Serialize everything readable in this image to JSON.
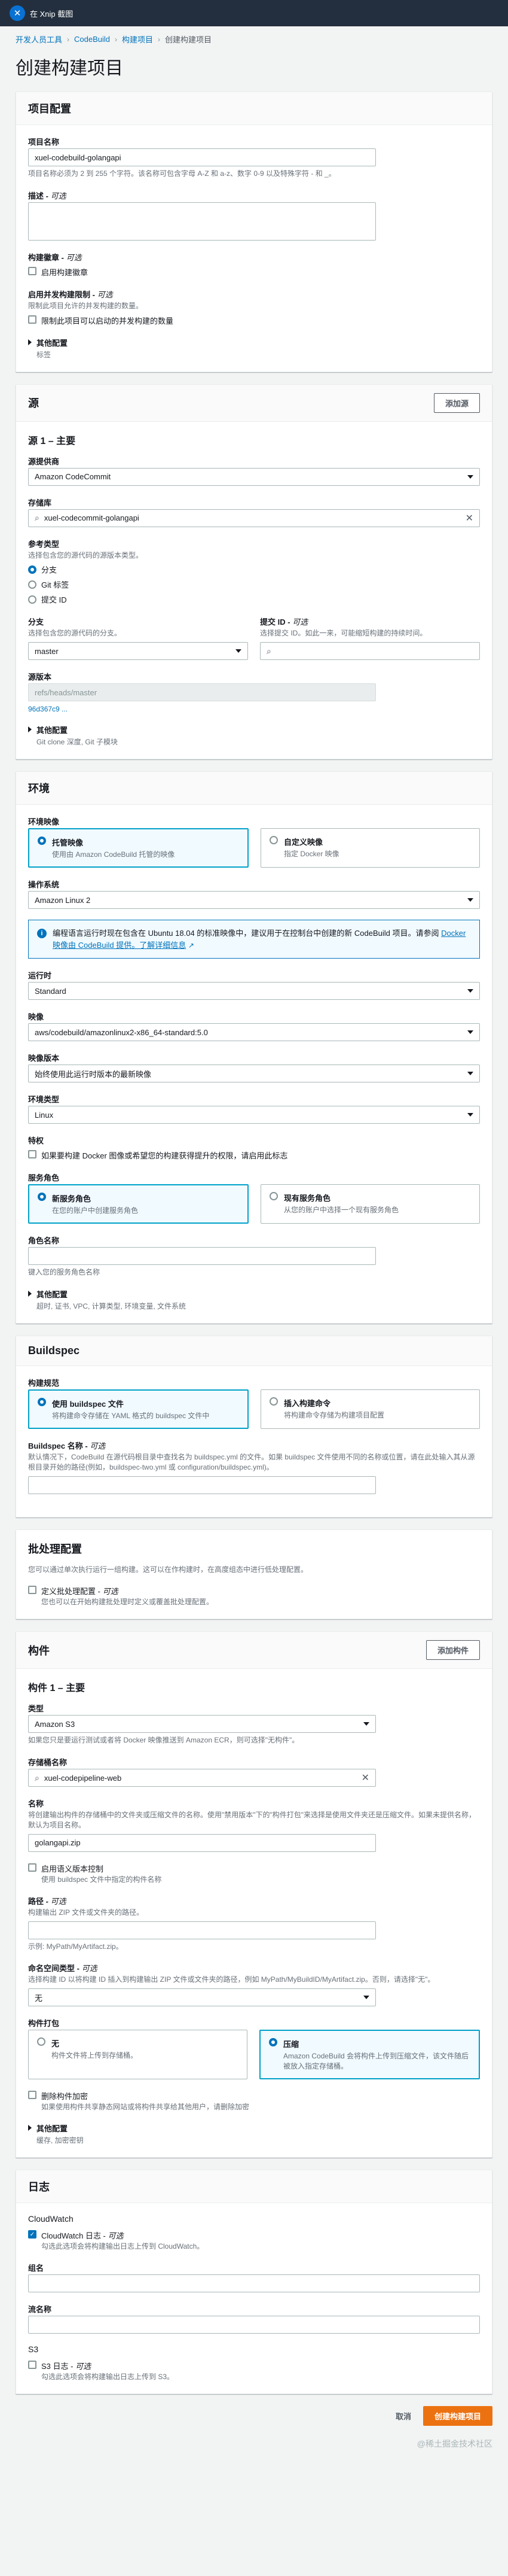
{
  "topbar": {
    "title": "在 Xnip 截图"
  },
  "breadcrumb": [
    "开发人员工具",
    "CodeBuild",
    "构建项目",
    "创建构建项目"
  ],
  "page_title": "创建构建项目",
  "project_config": {
    "header": "项目配置",
    "name_label": "项目名称",
    "name_value": "xuel-codebuild-golangapi",
    "name_hint": "项目名称必须为 2 到 255 个字符。该名称可包含字母 A-Z 和 a-z、数字 0-9 以及特殊字符 - 和 _。",
    "desc_label": "描述 - ",
    "desc_opt": "可选",
    "badge_label": "构建徽章 - ",
    "badge_opt": "可选",
    "badge_cb": "启用构建徽章",
    "concurrency_label": "启用并发构建限制 - ",
    "concurrency_opt": "可选",
    "concurrency_desc": "限制此项目允许的并发构建的数量。",
    "concurrency_cb": "限制此项目可以启动的并发构建的数量",
    "other_title": "其他配置",
    "other_desc": "标签"
  },
  "source": {
    "header": "源",
    "add_button": "添加源",
    "sub_title": "源 1 – 主要",
    "provider_label": "源提供商",
    "provider_value": "Amazon CodeCommit",
    "repo_label": "存储库",
    "repo_value": "xuel-codecommit-golangapi",
    "ref_label": "参考类型",
    "ref_desc": "选择包含您的源代码的源版本类型。",
    "ref_options": [
      "分支",
      "Git 标签",
      "提交 ID"
    ],
    "branch_label": "分支",
    "branch_desc": "选择包含您的源代码的分支。",
    "branch_value": "master",
    "commit_label": "提交 ID - ",
    "commit_opt": "可选",
    "commit_desc": "选择提交 ID。如此一来，可能缩短构建的持续时间。",
    "version_label": "源版本",
    "version_value": "refs/heads/master",
    "version_link": "96d367c9 ...",
    "other_title": "其他配置",
    "other_desc": "Git clone 深度, Git 子模块"
  },
  "environment": {
    "header": "环境",
    "image_label": "环境映像",
    "tile1_label": "托管映像",
    "tile1_desc": "使用由 Amazon CodeBuild 托管的映像",
    "tile2_label": "自定义映像",
    "tile2_desc": "指定 Docker 映像",
    "os_label": "操作系统",
    "os_value": "Amazon Linux 2",
    "info_text": "编程语言运行时现在包含在 Ubuntu 18.04 的标准映像中，建议用于在控制台中创建的新 CodeBuild 项目。请参阅 ",
    "info_link": "Docker 映像由 CodeBuild 提供。了解详细信息",
    "runtime_label": "运行时",
    "runtime_value": "Standard",
    "img_label": "映像",
    "img_value": "aws/codebuild/amazonlinux2-x86_64-standard:5.0",
    "imgver_label": "映像版本",
    "imgver_value": "始终使用此运行时版本的最新映像",
    "envtype_label": "环境类型",
    "envtype_value": "Linux",
    "priv_label": "特权",
    "priv_cb": "如果要构建 Docker 图像或希望您的构建获得提升的权限，请启用此标志",
    "role_label": "服务角色",
    "role_tile1_label": "新服务角色",
    "role_tile1_desc": "在您的账户中创建服务角色",
    "role_tile2_label": "现有服务角色",
    "role_tile2_desc": "从您的账户中选择一个现有服务角色",
    "rolename_label": "角色名称",
    "rolename_hint": "键入您的服务角色名称",
    "other_title": "其他配置",
    "other_desc": "超时, 证书, VPC, 计算类型, 环境变量, 文件系统"
  },
  "buildspec": {
    "header": "Buildspec",
    "spec_label": "构建规范",
    "tile1_label": "使用 buildspec 文件",
    "tile1_desc": "将构建命令存储在 YAML 格式的 buildspec 文件中",
    "tile2_label": "插入构建命令",
    "tile2_desc": "将构建命令存储为构建项目配置",
    "name_label": "Buildspec 名称 - ",
    "name_opt": "可选",
    "name_desc": "默认情况下，CodeBuild 在源代码根目录中查找名为 buildspec.yml 的文件。如果 buildspec 文件使用不同的名称或位置，请在此处输入其从源根目录开始的路径(例如，buildspec-two.yml 或 configuration/buildspec.yml)。"
  },
  "batch": {
    "header": "批处理配置",
    "desc": "您可以通过单次执行运行一组构建。这可以在作构建时，在高度组态中进行低处理配置。",
    "cb_label": "定义批处理配置 - ",
    "cb_opt": "可选",
    "cb_desc": "您也可以在开始构建批处理时定义或覆盖批处理配置。"
  },
  "artifacts": {
    "header": "构件",
    "add_button": "添加构件",
    "sub_title": "构件 1 – 主要",
    "type_label": "类型",
    "type_value": "Amazon S3",
    "type_hint": "如果您只是要运行测试或者将 Docker 映像推送到 Amazon ECR，则可选择\"无构件\"。",
    "bucket_label": "存储桶名称",
    "bucket_value": "xuel-codepipeline-web",
    "name_label": "名称",
    "name_desc": "将创建输出构件的存储桶中的文件夹或压缩文件的名称。使用\"禁用版本\"下的\"构件打包\"来选择是使用文件夹还是压缩文件。如果未提供名称，默认为项目名称。",
    "name_value": "golangapi.zip",
    "semver_cb": "启用语义版本控制",
    "semver_desc": "使用 buildspec 文件中指定的构件名称",
    "path_label": "路径 - ",
    "path_opt": "可选",
    "path_desc": "构建输出 ZIP 文件或文件夹的路径。",
    "path_hint": "示例: MyPath/MyArtifact.zip。",
    "ns_label": "命名空间类型 - ",
    "ns_opt": "可选",
    "ns_desc": "选择构建 ID 以将构建 ID 插入到构建输出 ZIP 文件或文件夹的路径，例如 MyPath/MyBuildID/MyArtifact.zip。否则，请选择\"无\"。",
    "ns_value": "无",
    "pack_label": "构件打包",
    "pack_tile1_label": "无",
    "pack_tile1_desc": "构件文件将上传到存储桶。",
    "pack_tile2_label": "压缩",
    "pack_tile2_desc": "Amazon CodeBuild 会将构件上传到压缩文件，该文件随后被放入指定存储桶。",
    "enc_cb": "删除构件加密",
    "enc_desc": "如果使用构件共享静态网站或将构件共享给其他用户，请删除加密",
    "other_title": "其他配置",
    "other_desc": "缓存, 加密密钥"
  },
  "logs": {
    "header": "日志",
    "cw_title": "CloudWatch",
    "cw_cb": "CloudWatch 日志 - ",
    "cw_opt": "可选",
    "cw_desc": "勾选此选项会将构建输出日志上传到 CloudWatch。",
    "group_label": "组名",
    "stream_label": "流名称",
    "s3_title": "S3",
    "s3_cb": "S3 日志 - ",
    "s3_opt": "可选",
    "s3_desc": "勾选此选项会将构建输出日志上传到 S3。"
  },
  "footer": {
    "cancel": "取消",
    "create": "创建构建项目"
  },
  "watermark": "@稀土掘金技术社区"
}
